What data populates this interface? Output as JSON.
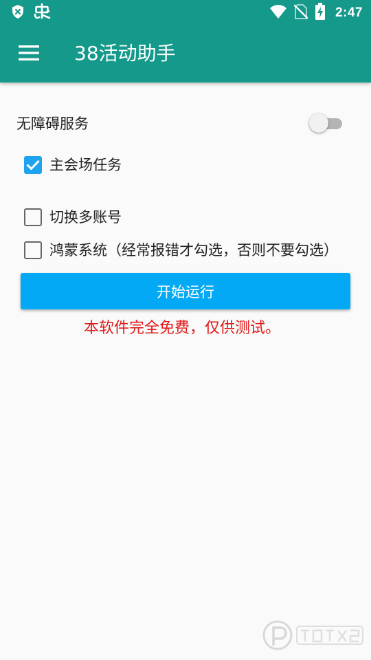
{
  "status_bar": {
    "time": "2:47",
    "left_icons": [
      "shield-x-icon",
      "bug-icon"
    ],
    "right_icons": [
      "wifi-icon",
      "no-sim-icon",
      "battery-charging-icon"
    ]
  },
  "toolbar": {
    "title": "38活动助手",
    "menu_icon": "hamburger-menu-icon"
  },
  "accessibility": {
    "label": "无障碍服务",
    "enabled": false
  },
  "options": [
    {
      "label": "主会场任务",
      "checked": true
    },
    {
      "label": "切换多账号",
      "checked": false
    },
    {
      "label": "鸿蒙系统（经常报错才勾选，否则不要勾选）",
      "checked": false
    }
  ],
  "start_button": {
    "label": "开始运行"
  },
  "notice": "本软件完全免费，仅供测试。",
  "colors": {
    "toolbar": "#14998a",
    "background": "#fafafa",
    "checkbox_checked": "#1ea4ee",
    "button": "#03a9f4",
    "notice_text": "#e01818"
  }
}
